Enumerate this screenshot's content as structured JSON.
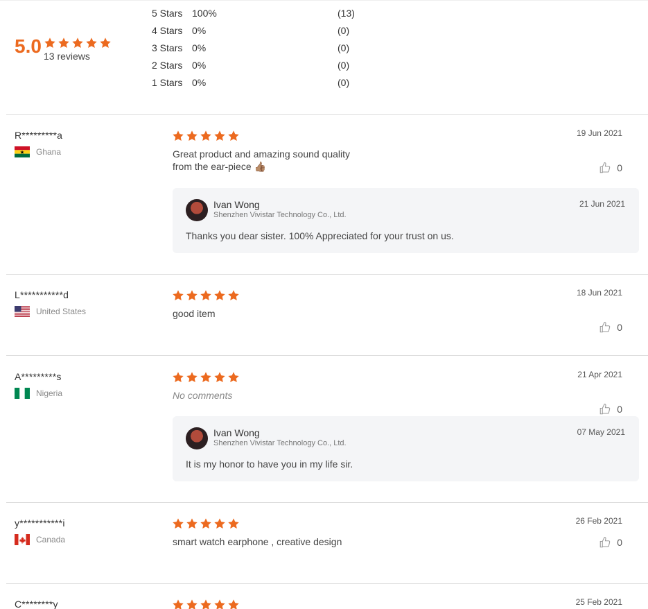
{
  "summary": {
    "average": "5.0",
    "average_stars": 5,
    "total_label": "13 reviews",
    "distribution": [
      {
        "label": "5 Stars",
        "percent": "100%",
        "count": "(13)"
      },
      {
        "label": "4 Stars",
        "percent": "0%",
        "count": "(0)"
      },
      {
        "label": "3 Stars",
        "percent": "0%",
        "count": "(0)"
      },
      {
        "label": "2 Stars",
        "percent": "0%",
        "count": "(0)"
      },
      {
        "label": "1 Stars",
        "percent": "0%",
        "count": "(0)"
      }
    ]
  },
  "colors": {
    "accent": "#ec6a1f",
    "reply_bg": "#f4f5f7"
  },
  "reviews": [
    {
      "name": "R*********a",
      "country": "Ghana",
      "flag": "ghana",
      "stars": 5,
      "comment": "Great product and amazing sound quality from the ear-piece 👍🏽",
      "date": "19 Jun 2021",
      "helpful": "0",
      "reply": {
        "name": "Ivan Wong",
        "company": "Shenzhen Vivistar Technology Co., Ltd.",
        "date": "21 Jun 2021",
        "text": "Thanks you dear sister. 100% Appreciated for your trust on us."
      }
    },
    {
      "name": "L***********d",
      "country": "United States",
      "flag": "us",
      "stars": 5,
      "comment": "good item",
      "date": "18 Jun 2021",
      "helpful": "0"
    },
    {
      "name": "A*********s",
      "country": "Nigeria",
      "flag": "nigeria",
      "stars": 5,
      "comment": "No comments",
      "comment_empty": true,
      "date": "21 Apr 2021",
      "helpful": "0",
      "reply": {
        "name": "Ivan Wong",
        "company": "Shenzhen Vivistar Technology Co., Ltd.",
        "date": "07 May 2021",
        "text": "It is my honor to have you in my life sir."
      }
    },
    {
      "name": "y***********i",
      "country": "Canada",
      "flag": "canada",
      "stars": 5,
      "comment": "smart watch earphone , creative design",
      "date": "26 Feb 2021",
      "helpful": "0"
    },
    {
      "name": "C********y",
      "stars": 5,
      "date": "25 Feb 2021"
    }
  ]
}
